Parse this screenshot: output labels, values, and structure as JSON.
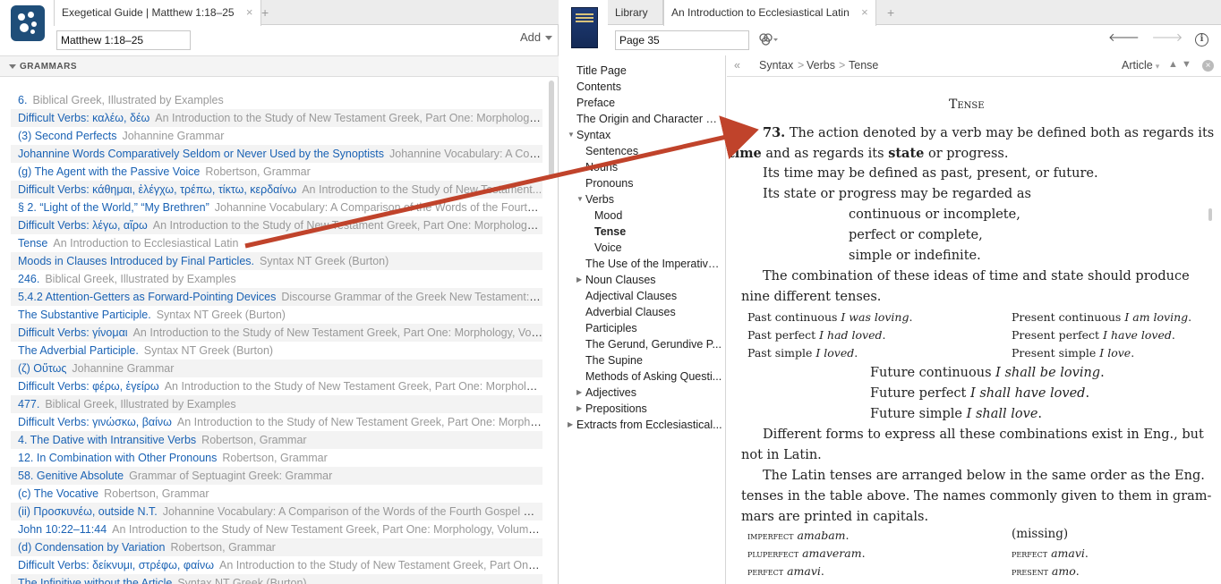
{
  "left": {
    "tab_title": "Exegetical Guide | Matthew 1:18–25",
    "tab_close": "×",
    "tab_add": "+",
    "reference": "Matthew 1:18–25",
    "add_label": "Add",
    "section_title": "GRAMMARS",
    "results": [
      {
        "title": "6.",
        "source": "Biblical Greek, Illustrated by Examples"
      },
      {
        "title": "Difficult Verbs: καλέω, δέω",
        "source": "An Introduction to the Study of New Testament Greek, Part One: Morphology,..."
      },
      {
        "title": "(3) Second Perfects",
        "source": "Johannine Grammar"
      },
      {
        "title": "Johannine Words Comparatively Seldom or Never Used by the Synoptists",
        "source": "Johannine Vocabulary: A Comp..."
      },
      {
        "title": "(g) The Agent with the Passive Voice",
        "source": "Robertson, Grammar"
      },
      {
        "title": "Difficult Verbs: κάθημαι, ἐλέγχω, τρέπω, τίκτω, κερδαίνω",
        "source": "An Introduction to the Study of New Testament..."
      },
      {
        "title": "§ 2. “Light of the World,” “My Brethren”",
        "source": "Johannine Vocabulary: A Comparison of the Words of the Fourth..."
      },
      {
        "title": "Difficult Verbs: λέγω, αἴρω",
        "source": "An Introduction to the Study of New Testament Greek, Part One: Morphology,..."
      },
      {
        "title": "Tense",
        "source": "An Introduction to Ecclesiastical Latin"
      },
      {
        "title": "Moods in Clauses Introduced by Final Particles.",
        "source": "Syntax NT Greek (Burton)"
      },
      {
        "title": "246.",
        "source": "Biblical Greek, Illustrated by Examples"
      },
      {
        "title": "5.4.2 Attention-Getters as Forward-Pointing Devices",
        "source": "Discourse Grammar of the Greek New Testament: A P..."
      },
      {
        "title": "The Substantive Participle.",
        "source": "Syntax NT Greek (Burton)"
      },
      {
        "title": "Difficult Verbs: γίνομαι",
        "source": "An Introduction to the Study of New Testament Greek, Part One: Morphology, Volu..."
      },
      {
        "title": "The Adverbial Participle.",
        "source": "Syntax NT Greek (Burton)"
      },
      {
        "title": "(ζ) Οὕτως",
        "source": "Johannine Grammar"
      },
      {
        "title": "Difficult Verbs: φέρω, ἐγείρω",
        "source": "An Introduction to the Study of New Testament Greek, Part One: Morpholog..."
      },
      {
        "title": "477.",
        "source": "Biblical Greek, Illustrated by Examples"
      },
      {
        "title": "Difficult Verbs: γινώσκω, βαίνω",
        "source": "An Introduction to the Study of New Testament Greek, Part One: Morphol..."
      },
      {
        "title": "4. The Dative with Intransitive Verbs",
        "source": "Robertson, Grammar"
      },
      {
        "title": "12. In Combination with Other Pronouns",
        "source": "Robertson, Grammar"
      },
      {
        "title": "58. Genitive Absolute",
        "source": "Grammar of Septuagint Greek: Grammar"
      },
      {
        "title": "(c) The Vocative",
        "source": "Robertson, Grammar"
      },
      {
        "title": "(ii) Προσκυνέω, outside N.T.",
        "source": "Johannine Vocabulary: A Comparison of the Words of the Fourth Gospel with..."
      },
      {
        "title": "John 10:22–11:44",
        "source": "An Introduction to the Study of New Testament Greek, Part One: Morphology, Volume 1:..."
      },
      {
        "title": "(d) Condensation by Variation",
        "source": "Robertson, Grammar"
      },
      {
        "title": "Difficult Verbs: δείκνυμι, στρέφω, φαίνω",
        "source": "An Introduction to the Study of New Testament Greek, Part One:..."
      },
      {
        "title": "The Infinitive without the Article",
        "source": "Syntax NT Greek (Burton)"
      }
    ]
  },
  "right": {
    "tabs": [
      "Library",
      "An Introduction to Ecclesiastical Latin"
    ],
    "tab_close": "×",
    "tab_add": "+",
    "page_ref": "Page 35",
    "nav_back": "🡐",
    "nav_fwd": "🡒",
    "info": "i",
    "toc_collapse": "«",
    "breadcrumb": [
      "Syntax",
      "Verbs",
      "Tense"
    ],
    "breadcrumb_sep": ">",
    "article_label": "Article",
    "toc": [
      {
        "label": "Title Page"
      },
      {
        "label": "Contents"
      },
      {
        "label": "Preface"
      },
      {
        "label": "The Origin and Character of..."
      },
      {
        "label": "Syntax"
      },
      {
        "label": "Sentences"
      },
      {
        "label": "Nouns"
      },
      {
        "label": "Pronouns"
      },
      {
        "label": "Verbs"
      },
      {
        "label": "Mood"
      },
      {
        "label": "Tense"
      },
      {
        "label": "Voice"
      },
      {
        "label": "The Use of the Imperative..."
      },
      {
        "label": "Noun Clauses"
      },
      {
        "label": "Adjectival Clauses"
      },
      {
        "label": "Adverbial Clauses"
      },
      {
        "label": "Participles"
      },
      {
        "label": "The Gerund, Gerundive P..."
      },
      {
        "label": "The Supine"
      },
      {
        "label": "Methods of Asking Questi..."
      },
      {
        "label": "Adjectives"
      },
      {
        "label": "Prepositions"
      },
      {
        "label": "Extracts from Ecclesiastical..."
      }
    ],
    "article": {
      "heading": "Tense",
      "p1_num": "73.",
      "p1_a": "The action denoted by a verb may be defined both as regards its",
      "p1_time": "time",
      "p1_b": "and as regards its",
      "p1_state": "state",
      "p1_c": "or progress.",
      "p2": "Its time may be defined as past, present, or future.",
      "p3": "Its state or progress may be regarded as",
      "opt1": "continuous or incomplete,",
      "opt2": "perfect or complete,",
      "opt3": "simple or indefinite.",
      "p4a": "The combination of these ideas of time and state should produce",
      "p4b": "nine different tenses.",
      "t_past_cont": "Past continuous",
      "t_past_cont_eg": "I was loving",
      "t_past_perf": "Past perfect",
      "t_past_perf_eg": "I had loved",
      "t_past_simple": "Past simple",
      "t_past_simple_eg": "I loved",
      "t_pres_cont": "Present continuous",
      "t_pres_cont_eg": "I am loving",
      "t_pres_perf": "Present perfect",
      "t_pres_perf_eg": "I have loved",
      "t_pres_simple": "Present simple",
      "t_pres_simple_eg": "I love",
      "t_fut_cont": "Future continuous",
      "t_fut_cont_eg": "I shall be loving",
      "t_fut_perf": "Future perfect",
      "t_fut_perf_eg": "I shall have loved",
      "t_fut_simple": "Future simple",
      "t_fut_simple_eg": "I shall love",
      "p5a": "Different forms to express all these combinations exist in Eng., but",
      "p5b": "not in Latin.",
      "p6a": "The Latin tenses are arranged below in the same order as the Eng.",
      "p6b": "tenses in the table above. The names commonly given to them in gram-",
      "p6c": "mars are printed in capitals.",
      "lat_imperfect": "imperfect",
      "lat_imperfect_eg": "amabam",
      "lat_pluperfect": "pluperfect",
      "lat_pluperfect_eg": "amaveram",
      "lat_perfect": "perfect",
      "lat_perfect_eg": "amavi",
      "lat_missing": "(missing)",
      "lat_perfect2": "perfect",
      "lat_perfect2_eg": "amavi",
      "lat_present": "present",
      "lat_present_eg": "amo"
    }
  },
  "colors": {
    "link": "#1a62b4",
    "muted": "#999999",
    "arrow": "#c0432b",
    "logo": "#1f4e79"
  }
}
